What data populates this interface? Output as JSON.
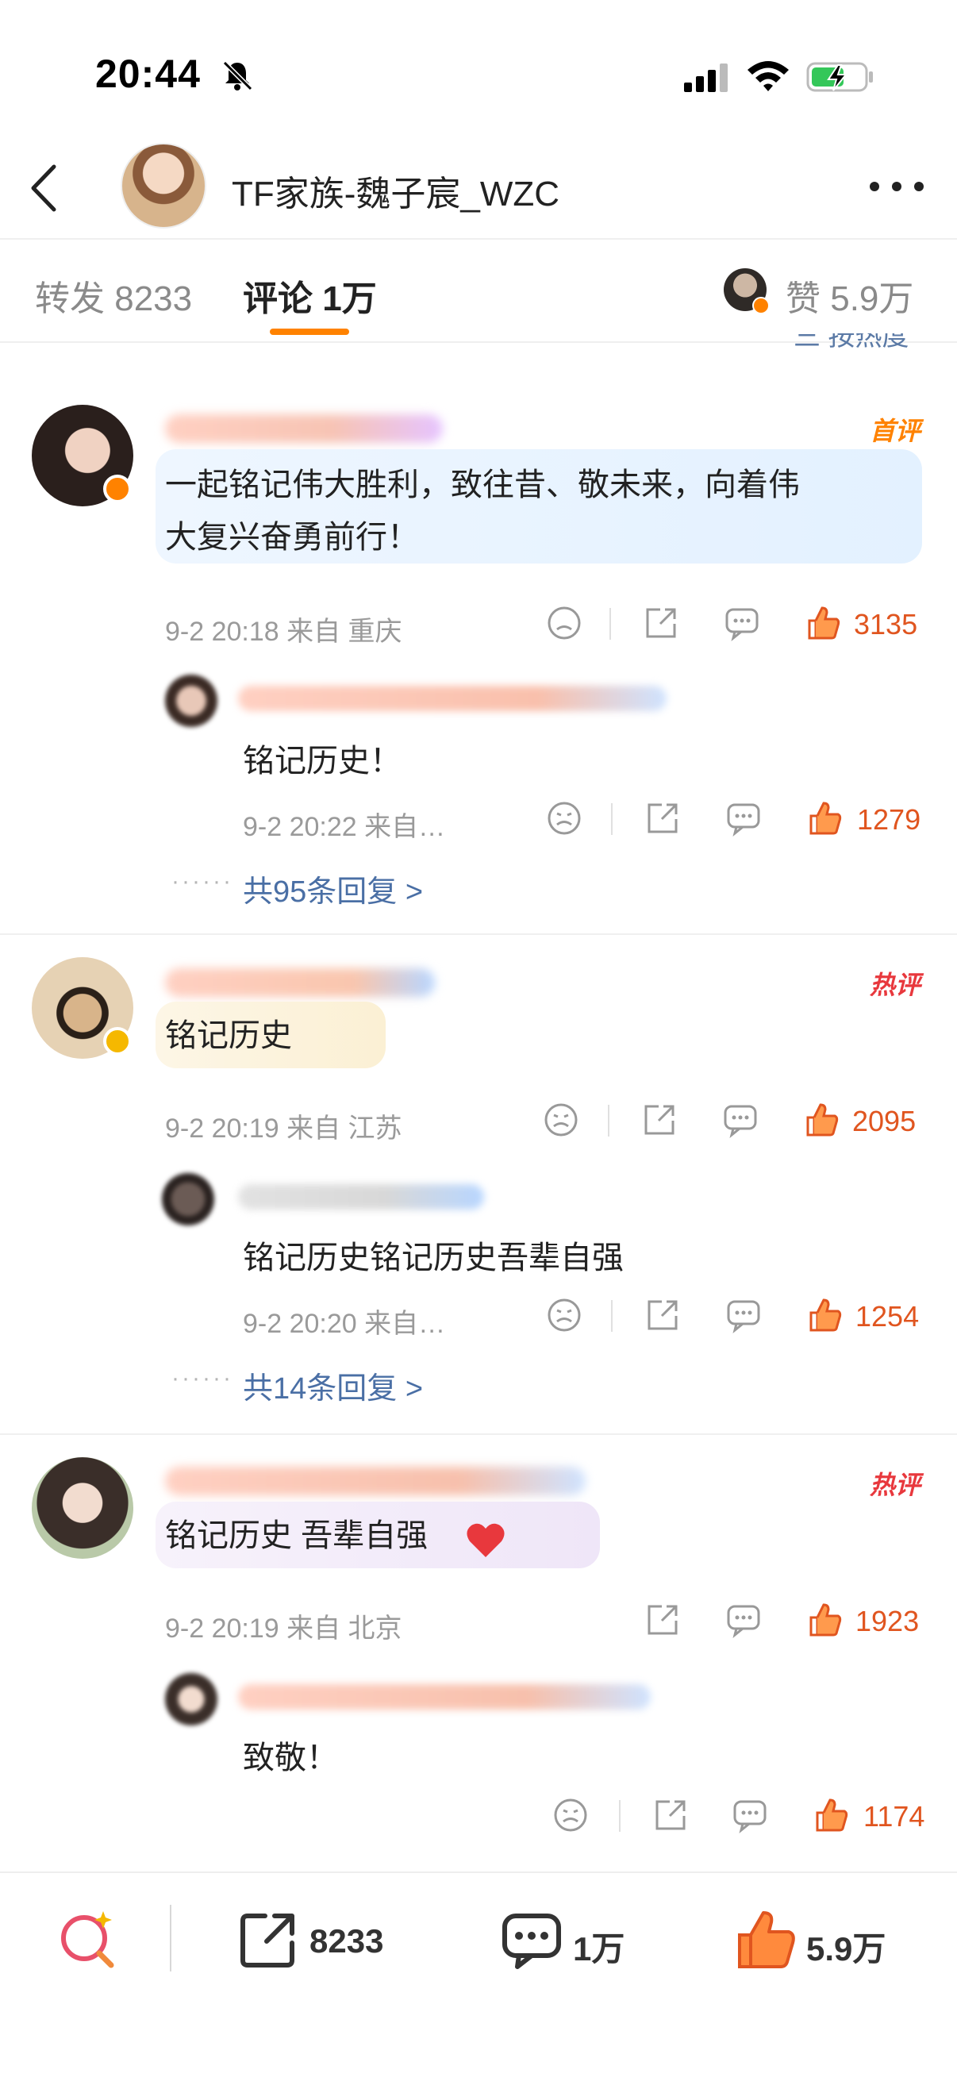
{
  "status_bar": {
    "time": "20:44"
  },
  "header": {
    "title": "TF家族-魏子宸_WZC"
  },
  "tabs": {
    "repost": "转发 8233",
    "comments": "评论 1万",
    "likes": "赞 5.9万"
  },
  "sort_label": "三 按热度",
  "comments": [
    {
      "badge": "首评",
      "text_line1": "一起铭记伟大胜利，致往昔、敬未来，向着伟",
      "text_line2": "大复兴奋勇前行！",
      "meta": "9-2 20:18  来自 重庆",
      "likes": "3135",
      "reply": {
        "text": "铭记历史！",
        "meta": "9-2 20:22  来自…",
        "likes": "1279"
      },
      "more_replies": "共95条回复 >"
    },
    {
      "badge": "热评",
      "text_line1": "铭记历史",
      "meta": "9-2 20:19  来自 江苏",
      "likes": "2095",
      "reply": {
        "text": "铭记历史铭记历史吾辈自强",
        "meta": "9-2 20:20  来自…",
        "likes": "1254"
      },
      "more_replies": "共14条回复 >"
    },
    {
      "badge": "热评",
      "text_line1": "铭记历史 吾辈自强",
      "meta": "9-2 20:19  来自 北京",
      "likes": "1923",
      "reply": {
        "text": "致敬！",
        "likes": "1174"
      }
    }
  ],
  "dots": "······",
  "bottom_bar": {
    "repost_count": "8233",
    "comment_count": "1万",
    "like_count": "5.9万"
  },
  "colors": {
    "accent": "#ff8200",
    "link": "#4a6fa5",
    "like": "#e0551f",
    "hot": "#e8383d"
  }
}
